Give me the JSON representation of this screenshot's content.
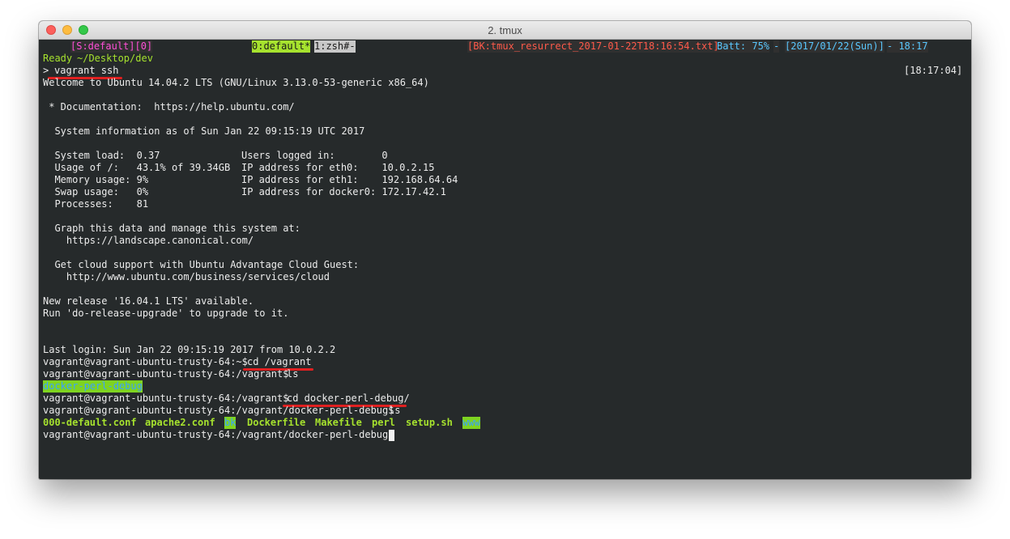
{
  "window": {
    "title": "2. tmux"
  },
  "status_bar": {
    "session": "[S:default][0]",
    "active_window": "0:default*",
    "other_window": "1:zsh#-",
    "resurrect": "[BK:tmux_resurrect_2017-01-22T18:16:54.txt]",
    "battery": "Batt: 75%",
    "sep": "-",
    "date": "[2017/01/22(Sun)]",
    "time": "- 18:17"
  },
  "prompt": {
    "status": "Ready",
    "dir": "~/Desktop/dev",
    "symbol": ">",
    "command": "vagrant ssh",
    "right_time": "[18:17:04]"
  },
  "motd": {
    "welcome": "Welcome to Ubuntu 14.04.2 LTS (GNU/Linux 3.13.0-53-generic x86_64)",
    "documentation": " * Documentation:  https://help.ubuntu.com/",
    "sysinfo_header": "  System information as of Sun Jan 22 09:15:19 UTC 2017",
    "system_load": "  System load:  0.37",
    "usage": "  Usage of /:   43.1% of 39.34GB",
    "memory": "  Memory usage: 9%",
    "swap": "  Swap usage:   0%",
    "processes": "  Processes:    81",
    "users_logged_in": "Users logged in:        0",
    "ip_eth0": "IP address for eth0:    10.0.2.15",
    "ip_eth1": "IP address for eth1:    192.168.64.64",
    "ip_docker0": "IP address for docker0: 172.17.42.1",
    "graph_line": "  Graph this data and manage this system at:",
    "graph_url": "    https://landscape.canonical.com/",
    "cloud_line": "  Get cloud support with Ubuntu Advantage Cloud Guest:",
    "cloud_url": "    http://www.ubuntu.com/business/services/cloud",
    "new_release": "New release '16.04.1 LTS' available.",
    "upgrade_hint": "Run 'do-release-upgrade' to upgrade to it.",
    "last_login": "Last login: Sun Jan 22 09:15:19 2017 from 10.0.2.2"
  },
  "session": {
    "prompt_home": "vagrant@vagrant-ubuntu-trusty-64:~$",
    "cmd_cd_vagrant": "cd /vagrant",
    "prompt_vagrant": "vagrant@vagrant-ubuntu-trusty-64:/vagrant$",
    "cmd_ls": "ls",
    "ls1_item": "docker-perl-debug",
    "cmd_cd_debug": "cd docker-perl-debug/",
    "prompt_debug": "vagrant@vagrant-ubuntu-trusty-64:/vagrant/docker-perl-debug$",
    "ls2_items": [
      "000-default.conf",
      "apache2.conf",
      "bk",
      "Dockerfile",
      "Makefile",
      "perl",
      "setup.sh",
      "www"
    ]
  },
  "colors": {
    "terminal_bg": "#262a2b",
    "text": "#ececec",
    "green": "#a6e22e",
    "magenta": "#ff4fd8",
    "red": "#ff5a4a",
    "blue": "#5ac8ff",
    "underline": "#e02020",
    "dir_highlight": "#7ed321"
  }
}
